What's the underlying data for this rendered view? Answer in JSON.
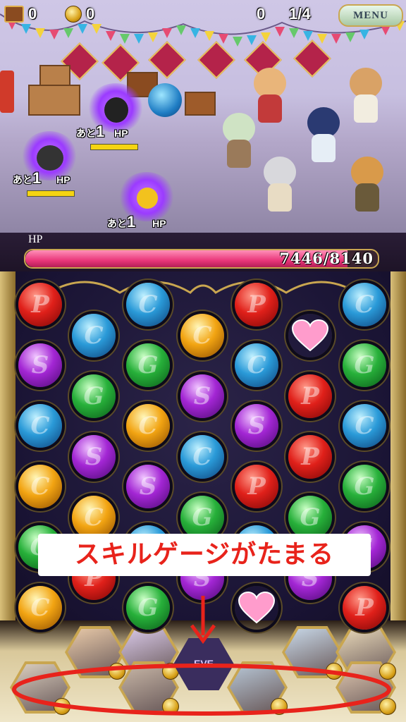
{
  "hud": {
    "treasure_count": "0",
    "coin_count": "0",
    "score": "0",
    "wave": "1/4",
    "menu_label": "MENU"
  },
  "enemies": [
    {
      "name": "black-cat-enemy",
      "turn_prefix": "あと",
      "turn_count": "1",
      "hp_label": "HP",
      "hp_fraction": 1.0
    },
    {
      "name": "black-bear-enemy",
      "turn_prefix": "あと",
      "turn_count": "1",
      "hp_label": "HP",
      "hp_fraction": 1.0
    },
    {
      "name": "yellow-mouse-enemy",
      "turn_prefix": "あと",
      "turn_count": "1",
      "hp_label": "HP",
      "hp_fraction": 1.0
    }
  ],
  "player_hp": {
    "label": "HP",
    "current": 7446,
    "max": 8140,
    "text": "7446/8140"
  },
  "board": {
    "orb_letters": {
      "red": "P",
      "blue": "C",
      "green": "G",
      "purple": "S",
      "yellow": "C",
      "heart": ""
    },
    "columns": [
      [
        "red",
        "purple",
        "blue",
        "yellow",
        "green",
        "yellow"
      ],
      [
        "blue",
        "green",
        "purple",
        "yellow",
        "red",
        "purple"
      ],
      [
        "blue",
        "green",
        "yellow",
        "purple",
        "blue",
        "green"
      ],
      [
        "yellow",
        "purple",
        "blue",
        "green",
        "purple",
        "blue"
      ],
      [
        "red",
        "blue",
        "purple",
        "red",
        "blue",
        "heart"
      ],
      [
        "heart",
        "red",
        "red",
        "green",
        "purple",
        "red"
      ],
      [
        "blue",
        "green",
        "blue",
        "green",
        "purple",
        "red"
      ]
    ]
  },
  "caption": "スキルゲージがたまる",
  "party": {
    "center_label": "EVE",
    "members": [
      "member-1",
      "member-2",
      "member-3",
      "member-4",
      "member-5",
      "member-6",
      "member-7",
      "member-8"
    ]
  },
  "colors": {
    "hp_fill": "#e9367a",
    "caption_text": "#e8231b",
    "annotation": "#e8231b",
    "frame_gold": "#c9a650"
  }
}
